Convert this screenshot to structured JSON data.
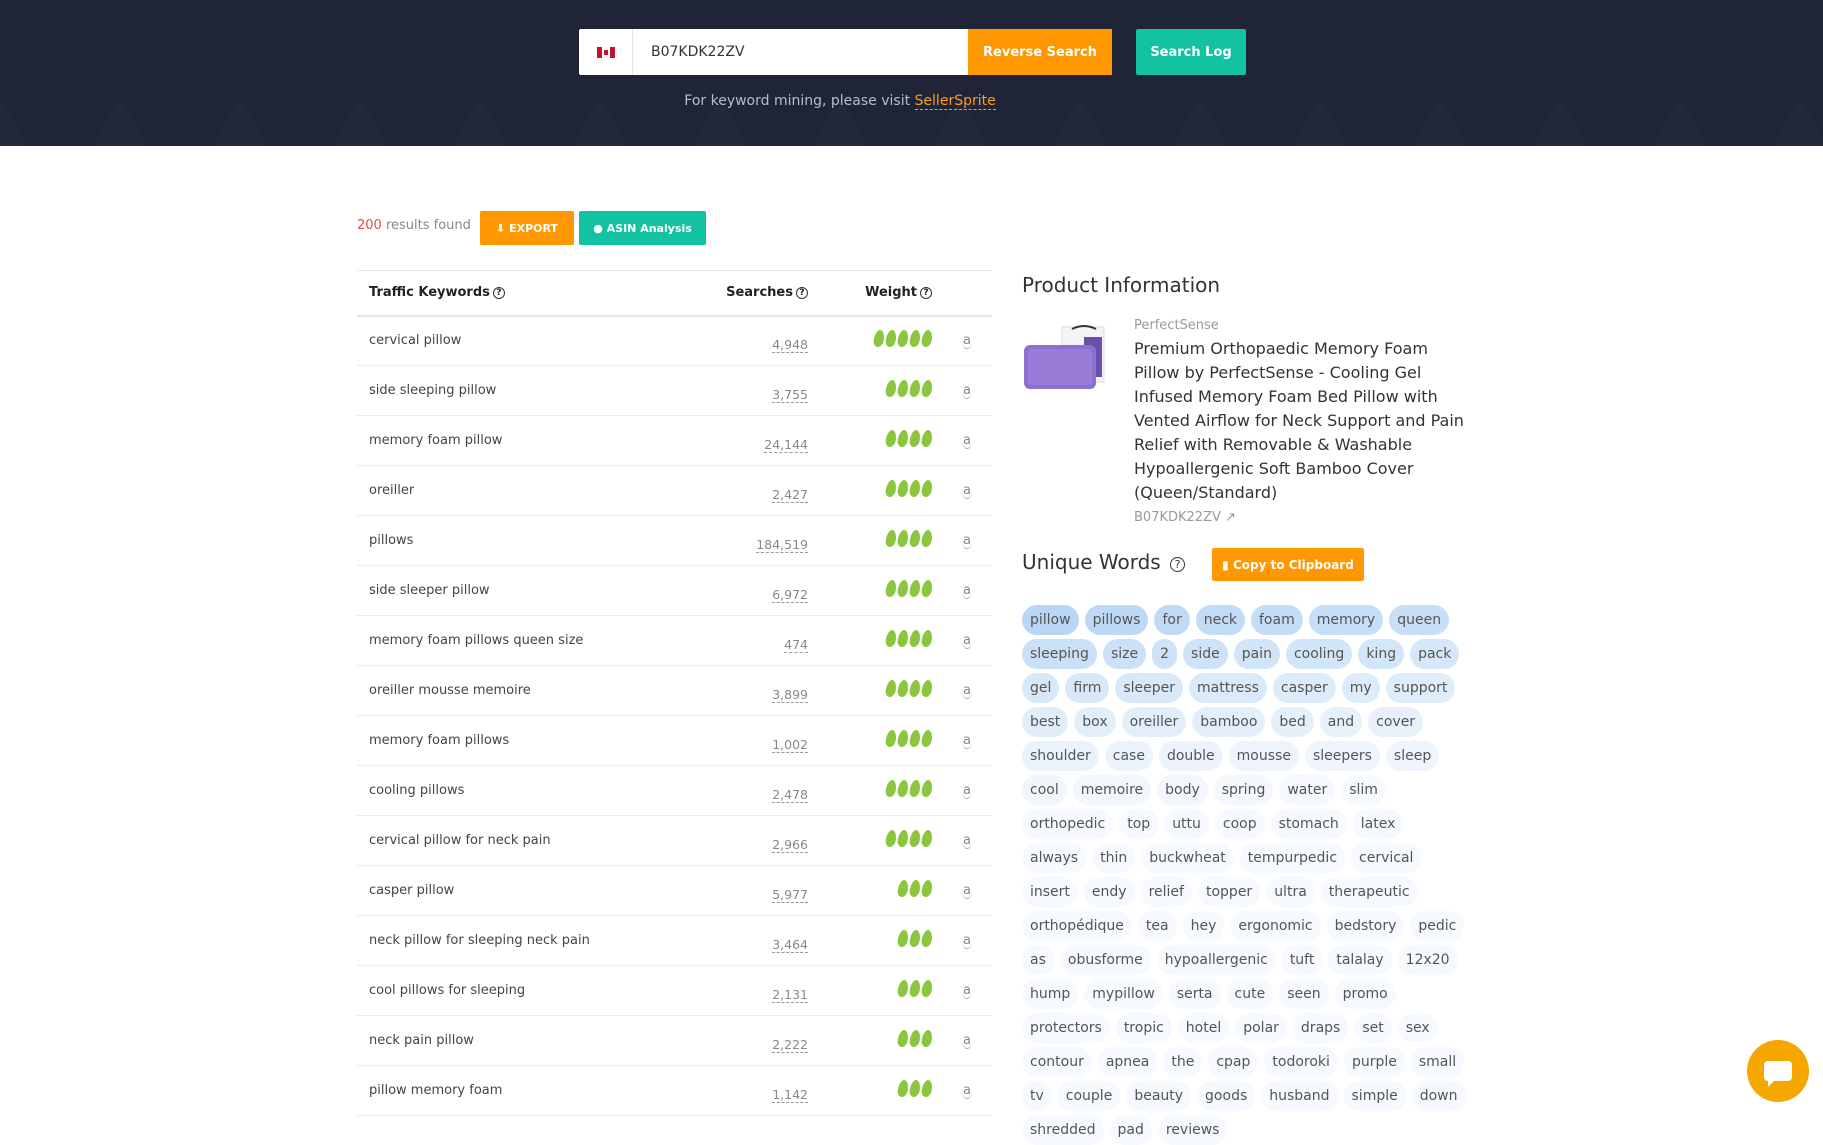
{
  "search": {
    "value": "B07KDK22ZV",
    "reverse_label": "Reverse Search",
    "log_label": "Search Log",
    "hint": "For keyword mining, please visit ",
    "hint_link": "SellerSprite",
    "marketplace": "canada-flag"
  },
  "results": {
    "count": "200",
    "label": " results found",
    "export_label": "EXPORT",
    "asin_label": "ASIN Analysis"
  },
  "table": {
    "headers": [
      "Traffic Keywords",
      "Searches",
      "Weight"
    ],
    "rows": [
      {
        "keyword": "cervical pillow",
        "searches": "4,948",
        "weight": 5
      },
      {
        "keyword": "side sleeping pillow",
        "searches": "3,755",
        "weight": 4
      },
      {
        "keyword": "memory foam pillow",
        "searches": "24,144",
        "weight": 4
      },
      {
        "keyword": "oreiller",
        "searches": "2,427",
        "weight": 4
      },
      {
        "keyword": "pillows",
        "searches": "184,519",
        "weight": 4
      },
      {
        "keyword": "side sleeper pillow",
        "searches": "6,972",
        "weight": 4
      },
      {
        "keyword": "memory foam pillows queen size",
        "searches": "474",
        "weight": 4
      },
      {
        "keyword": "oreiller mousse memoire",
        "searches": "3,899",
        "weight": 4
      },
      {
        "keyword": "memory foam pillows",
        "searches": "1,002",
        "weight": 4
      },
      {
        "keyword": "cooling pillows",
        "searches": "2,478",
        "weight": 4
      },
      {
        "keyword": "cervical pillow for neck pain",
        "searches": "2,966",
        "weight": 4
      },
      {
        "keyword": "casper pillow",
        "searches": "5,977",
        "weight": 3
      },
      {
        "keyword": "neck pillow for sleeping neck pain",
        "searches": "3,464",
        "weight": 3
      },
      {
        "keyword": "cool pillows for sleeping",
        "searches": "2,131",
        "weight": 3
      },
      {
        "keyword": "neck pain pillow",
        "searches": "2,222",
        "weight": 3
      },
      {
        "keyword": "pillow memory foam",
        "searches": "1,142",
        "weight": 3
      }
    ]
  },
  "product": {
    "heading": "Product Information",
    "brand": "PerfectSense",
    "title": "Premium Orthopaedic Memory Foam Pillow by PerfectSense - Cooling Gel Infused Memory Foam Bed Pillow with Vented Airflow for Neck Support and Pain Relief with Removable & Washable Hypoallergenic Soft Bamboo Cover (Queen/Standard)",
    "asin": "B07KDK22ZV"
  },
  "unique_words": {
    "heading": "Unique Words",
    "copy_label": "Copy to Clipboard",
    "words": [
      "pillow",
      "pillows",
      "for",
      "neck",
      "foam",
      "memory",
      "queen",
      "sleeping",
      "size",
      "2",
      "side",
      "pain",
      "cooling",
      "king",
      "pack",
      "gel",
      "firm",
      "sleeper",
      "mattress",
      "casper",
      "my",
      "support",
      "best",
      "box",
      "oreiller",
      "bamboo",
      "bed",
      "and",
      "cover",
      "shoulder",
      "case",
      "double",
      "mousse",
      "sleepers",
      "sleep",
      "cool",
      "memoire",
      "body",
      "spring",
      "water",
      "slim",
      "orthopedic",
      "top",
      "uttu",
      "coop",
      "stomach",
      "latex",
      "always",
      "thin",
      "buckwheat",
      "tempurpedic",
      "cervical",
      "insert",
      "endy",
      "relief",
      "topper",
      "ultra",
      "therapeutic",
      "orthopédique",
      "tea",
      "hey",
      "ergonomic",
      "bedstory",
      "pedic",
      "as",
      "obusforme",
      "hypoallergenic",
      "tuft",
      "talalay",
      "12x20",
      "hump",
      "mypillow",
      "serta",
      "cute",
      "seen",
      "promo",
      "protectors",
      "tropic",
      "hotel",
      "polar",
      "draps",
      "set",
      "sex",
      "contour",
      "apnea",
      "the",
      "cpap",
      "todoroki",
      "purple",
      "small",
      "tv",
      "couple",
      "beauty",
      "goods",
      "husband",
      "simple",
      "down",
      "shredded",
      "pad",
      "reviews"
    ]
  },
  "colors": {
    "header_bg": "#1f2537",
    "orange": "#ff9800",
    "teal": "#12c2a1",
    "leaf": "#8cc63f",
    "chat": "#f5a700"
  }
}
